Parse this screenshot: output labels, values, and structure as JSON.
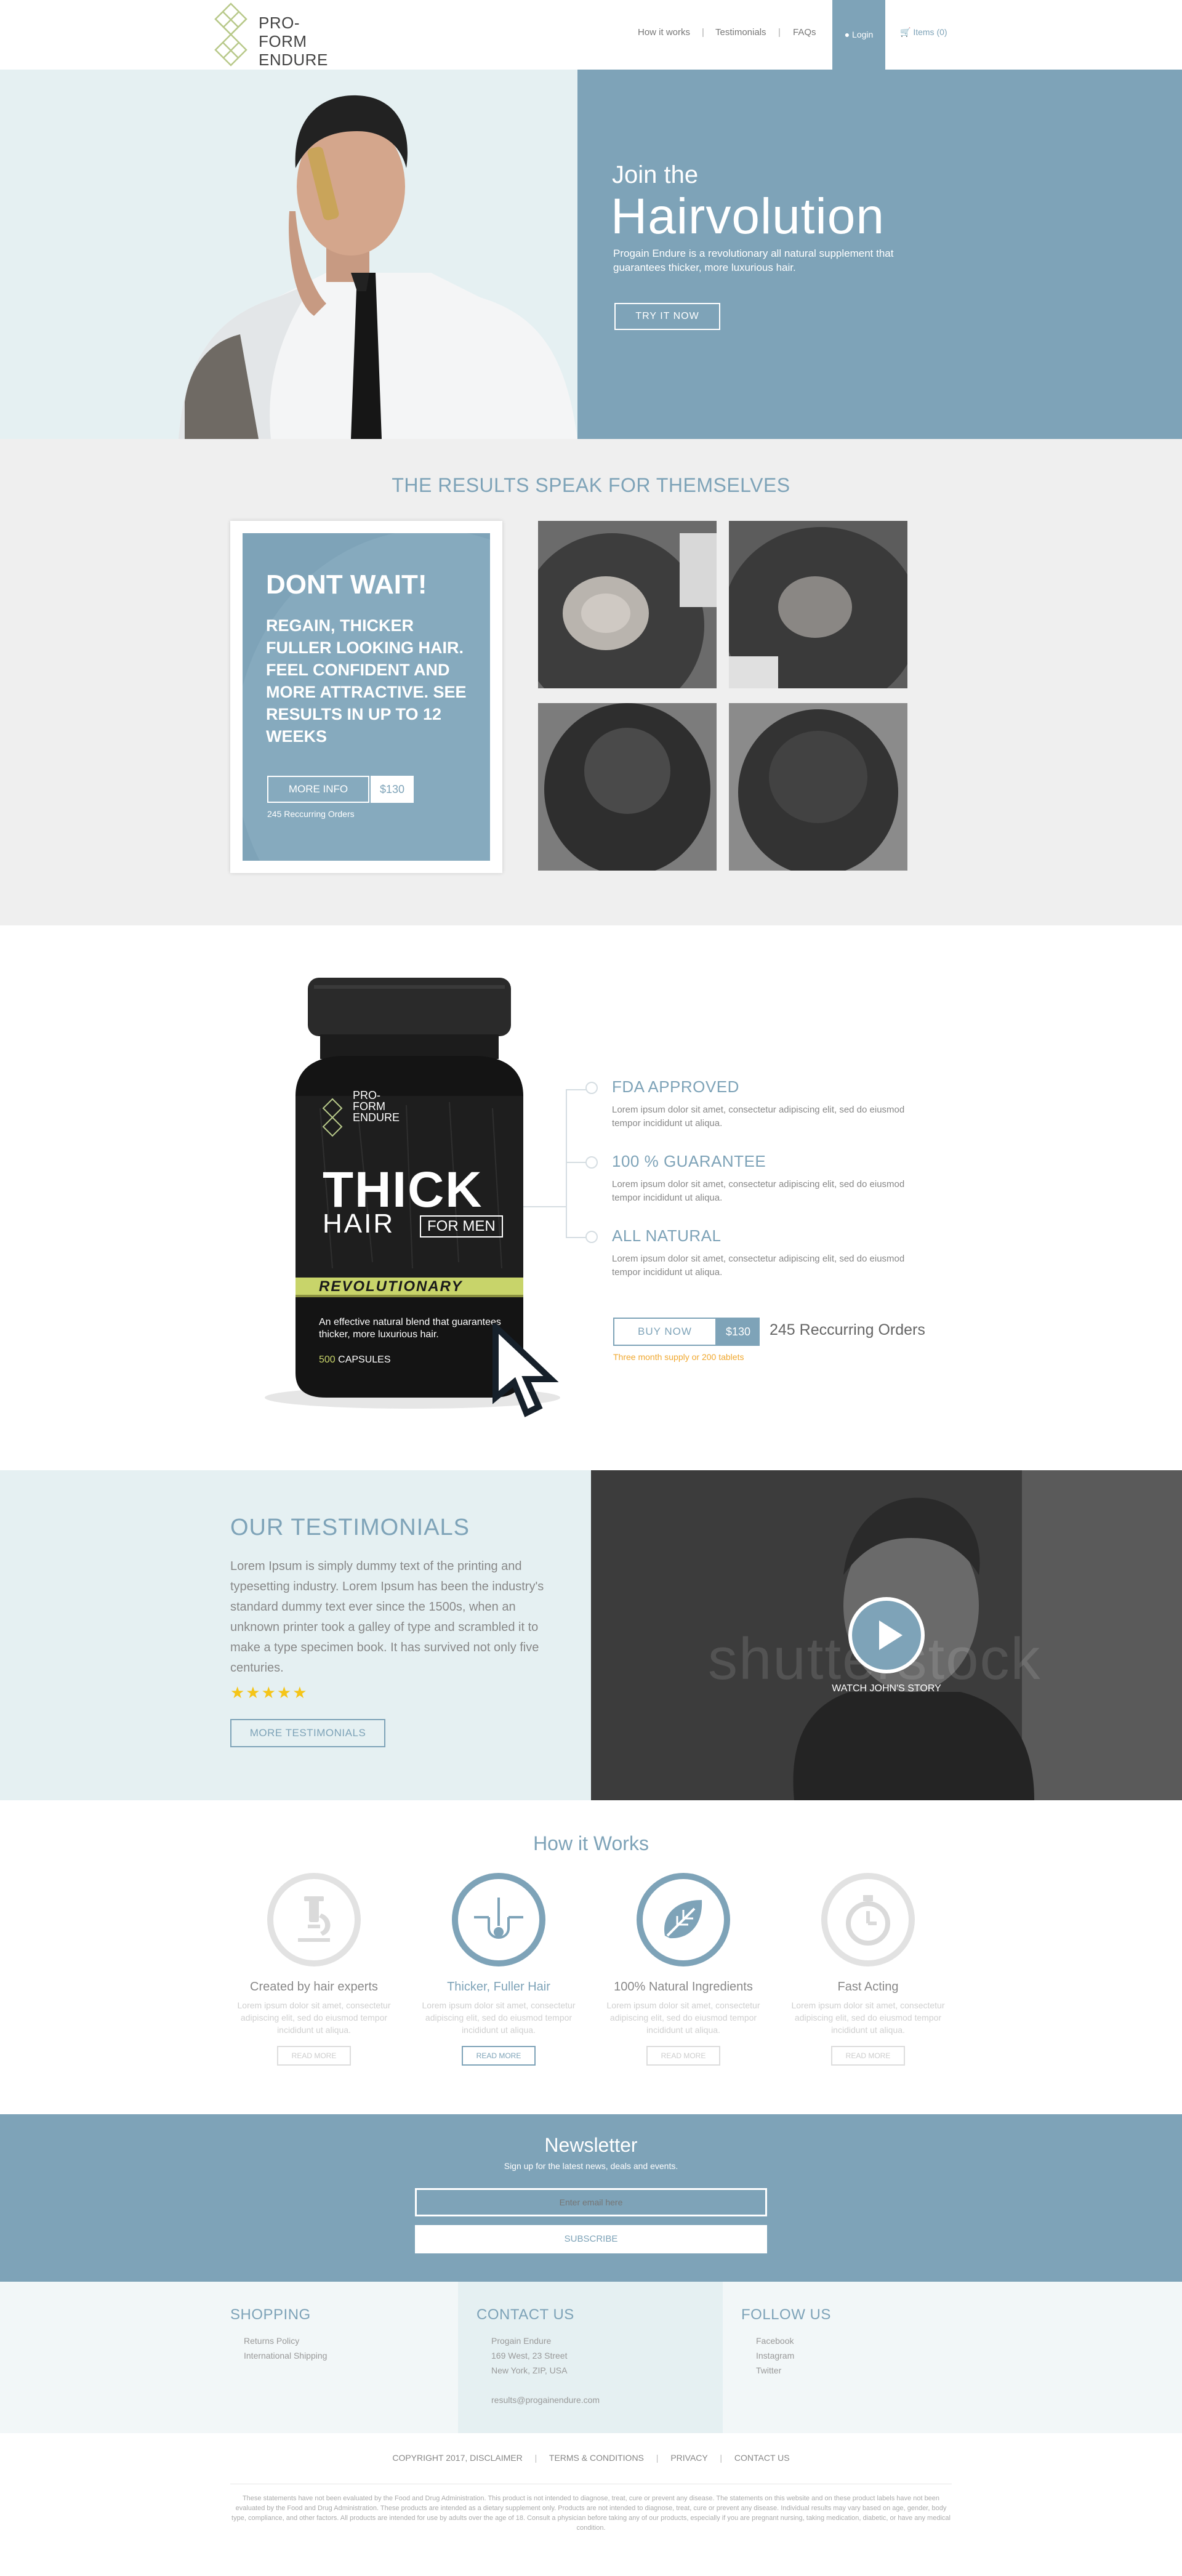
{
  "header": {
    "logo_line1": "PRO-",
    "logo_line2": "FORM",
    "logo_line3": "ENDURE",
    "nav": [
      "How it works",
      "Testimonials",
      "FAQs"
    ],
    "login": "Login",
    "cart": "Items (0)"
  },
  "hero": {
    "kicker": "Join the",
    "title": "Hairvolution",
    "description": "Progain Endure is a revolutionary all natural supplement that guarantees thicker, more luxurious hair.",
    "cta": "TRY IT NOW"
  },
  "results": {
    "title": "THE RESULTS SPEAK FOR THEMSELVES",
    "card_heading": "DONT WAIT!",
    "card_text": "REGAIN, THICKER FULLER LOOKING HAIR. FEEL CONFIDENT AND MORE ATTRACTIVE. SEE RESULTS IN UP TO 12 WEEKS",
    "more_info": "MORE INFO",
    "price": "$130",
    "orders": "245 Reccurring Orders"
  },
  "product": {
    "bottle": {
      "brand1": "PRO-",
      "brand2": "FORM",
      "brand3": "ENDURE",
      "thick": "THICK",
      "hair": "HAIR",
      "for_men": "FOR MEN",
      "revolutionary": "REVOLUTIONARY",
      "blurb": "An effective natural blend that guarantees thicker, more luxurious hair.",
      "capsules_count": "500",
      "capsules_label": "CAPSULES"
    },
    "features": [
      {
        "title": "FDA APPROVED",
        "text": "Lorem ipsum dolor sit amet, consectetur adipiscing elit, sed do eiusmod tempor incididunt ut aliqua."
      },
      {
        "title": "100 % GUARANTEE",
        "text": "Lorem ipsum dolor sit amet, consectetur adipiscing elit, sed do eiusmod tempor incididunt ut aliqua."
      },
      {
        "title": "ALL NATURAL",
        "text": "Lorem ipsum dolor sit amet, consectetur adipiscing elit, sed do eiusmod tempor incididunt ut aliqua."
      }
    ],
    "buy_now": "BUY NOW",
    "price": "$130",
    "orders": "245 Reccurring Orders",
    "note": "Three month supply or 200 tablets"
  },
  "testimonials": {
    "title": "OUR  TESTIMONIALS",
    "text": "Lorem Ipsum is simply dummy text of the printing and typesetting industry. Lorem Ipsum has been the industry's standard dummy text ever since the 1500s, when an unknown printer took a galley of type and scrambled it to make a type specimen book. It has survived not only five centuries.",
    "stars": "★★★★★",
    "rating": 5,
    "more": "MORE TESTIMONIALS",
    "watch": "WATCH JOHN'S STORY",
    "watermark": "shutterstock"
  },
  "how": {
    "title": "How it Works",
    "items": [
      {
        "icon": "microscope-icon",
        "title": "Created by hair experts",
        "text": "Lorem ipsum dolor sit amet, consectetur adipiscing elit, sed do eiusmod tempor incididunt ut aliqua.",
        "button": "READ MORE"
      },
      {
        "icon": "hair-follicle-icon",
        "title": "Thicker, Fuller Hair",
        "text": "Lorem ipsum dolor sit amet, consectetur adipiscing elit, sed do eiusmod tempor incididunt ut aliqua.",
        "button": "READ MORE"
      },
      {
        "icon": "leaf-icon",
        "title": "100% Natural Ingredients",
        "text": "Lorem ipsum dolor sit amet, consectetur adipiscing elit, sed do eiusmod tempor incididunt ut aliqua.",
        "button": "READ MORE"
      },
      {
        "icon": "stopwatch-icon",
        "title": "Fast Acting",
        "text": "Lorem ipsum dolor sit amet, consectetur adipiscing elit, sed do eiusmod tempor incididunt ut aliqua.",
        "button": "READ MORE"
      }
    ]
  },
  "newsletter": {
    "title": "Newsletter",
    "subtitle": "Sign up for the latest news, deals and events.",
    "placeholder": "Enter email here",
    "button": "SUBSCRIBE"
  },
  "footer": {
    "shopping_title": "SHOPPING",
    "shopping_links": [
      "Returns Policy",
      "International Shipping"
    ],
    "contact_title": "CONTACT US",
    "contact_lines": [
      "Progain Endure",
      "169 West, 23 Street",
      "New York, ZIP, USA"
    ],
    "contact_email": "results@progainendure.com",
    "follow_title": "FOLLOW US",
    "follow_links": [
      "Facebook",
      "Instagram",
      "Twitter"
    ],
    "bottom_links": [
      "COPYRIGHT 2017, DISCLAIMER",
      "TERMS & CONDITIONS",
      "PRIVACY",
      "CONTACT US"
    ],
    "disclaimer": "These statements have not been evaluated by the Food and Drug Administration. This product is not intended to diagnose, treat, cure or prevent any disease. The statements on this website and on these product labels have not been evaluated by the Food and Drug Administration. These products are intended as a dietary supplement only. Products are not intended to diagnose, treat, cure or prevent any disease. Individual results may vary based on age, gender, body type, compliance, and other factors. All products are intended for use by adults over the age of 18. Consult a physician before taking any of our products, especially if you are pregnant nursing, taking medication, diabetic, or have any medical condition."
  },
  "colors": {
    "accent": "#7ea3b8",
    "light_bg": "#e5f0f2",
    "gray_bg": "#efefef",
    "star": "#f5c518",
    "note": "#f0a830"
  }
}
